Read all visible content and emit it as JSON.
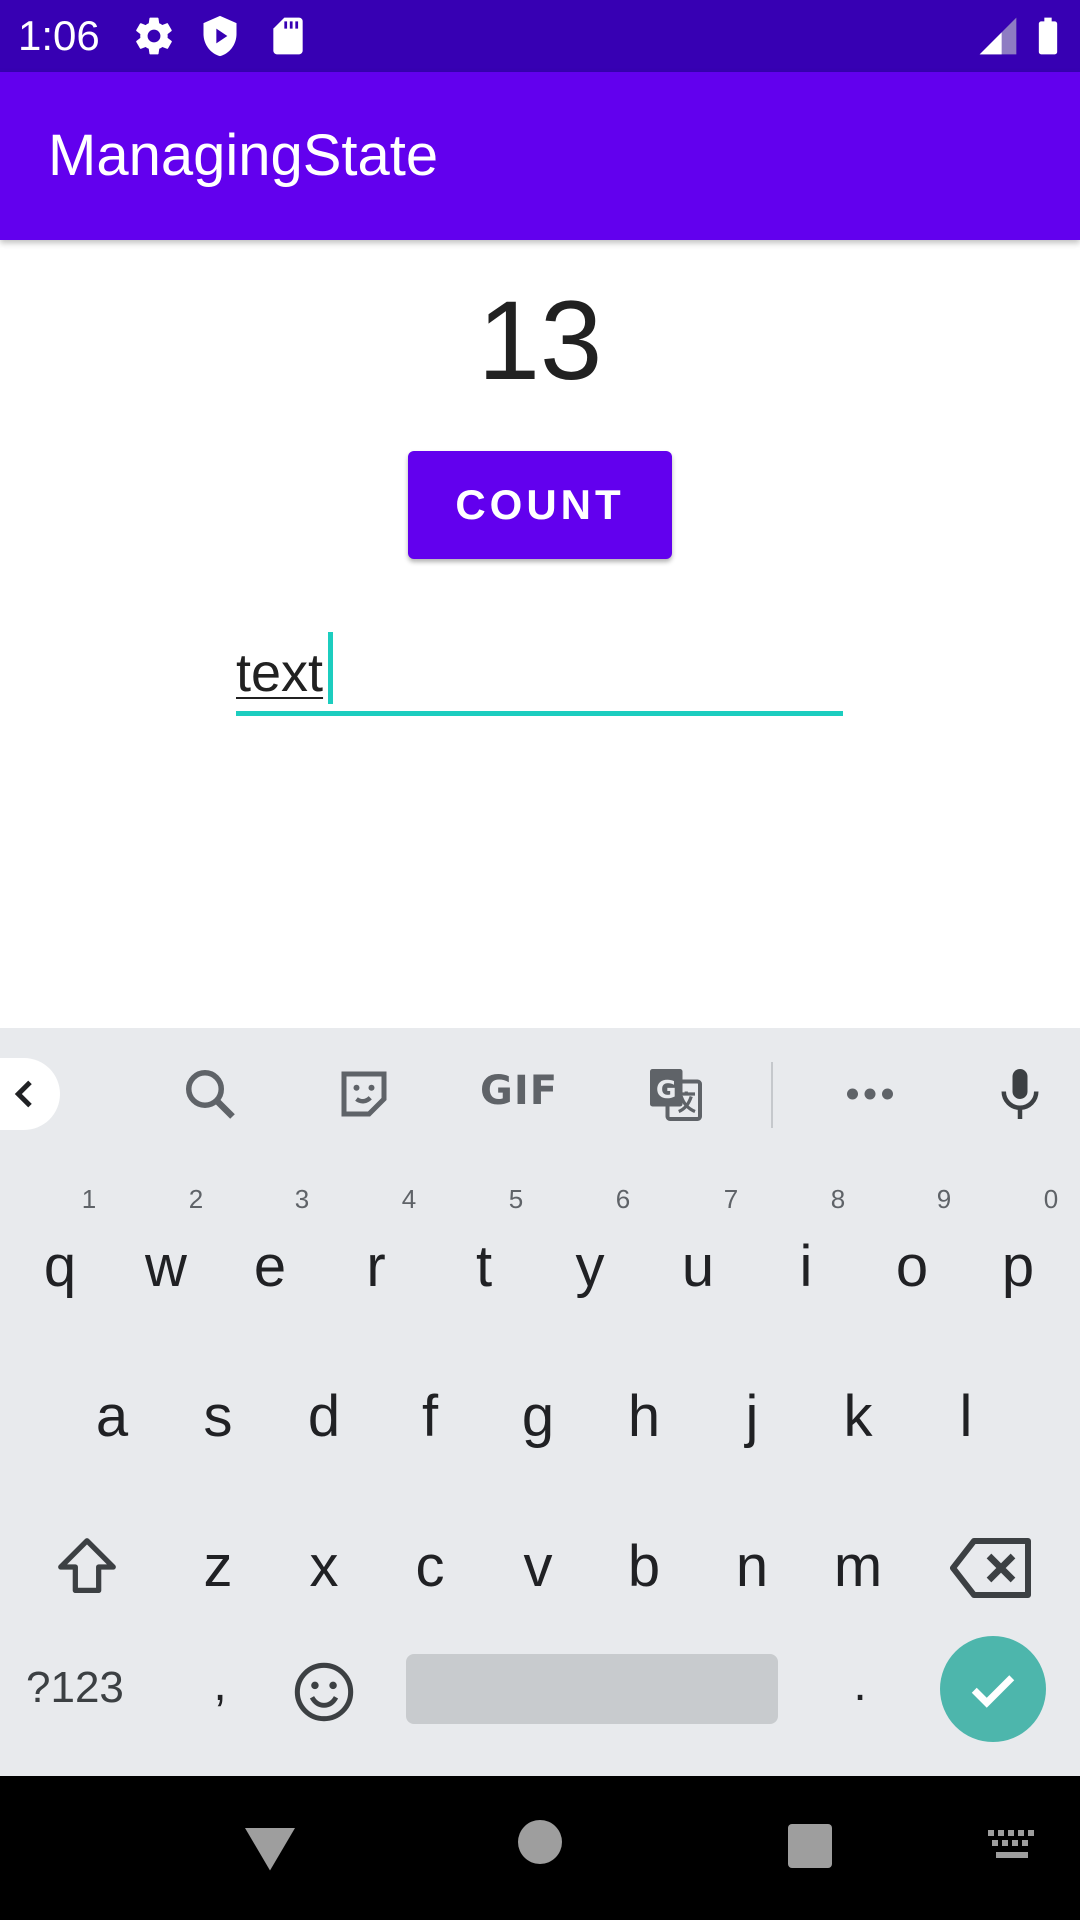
{
  "status_bar": {
    "time": "1:06",
    "icons": [
      "settings-icon",
      "shield-icon",
      "sd-card-icon",
      "signal-icon",
      "battery-icon"
    ]
  },
  "app_bar": {
    "title": "ManagingState",
    "color": "#6200ee"
  },
  "counter": {
    "value": "13"
  },
  "count_button": {
    "label": "COUNT"
  },
  "text_field": {
    "value": "text",
    "accent_color": "#1ccdbf"
  },
  "keyboard": {
    "toolbar": [
      "back-icon",
      "search-icon",
      "sticker-icon",
      "gif-icon",
      "translate-icon",
      "more-icon",
      "microphone-icon"
    ],
    "gif_label": "GIF",
    "row1": [
      {
        "key": "q",
        "hint": "1"
      },
      {
        "key": "w",
        "hint": "2"
      },
      {
        "key": "e",
        "hint": "3"
      },
      {
        "key": "r",
        "hint": "4"
      },
      {
        "key": "t",
        "hint": "5"
      },
      {
        "key": "y",
        "hint": "6"
      },
      {
        "key": "u",
        "hint": "7"
      },
      {
        "key": "i",
        "hint": "8"
      },
      {
        "key": "o",
        "hint": "9"
      },
      {
        "key": "p",
        "hint": "0"
      }
    ],
    "row2": [
      "a",
      "s",
      "d",
      "f",
      "g",
      "h",
      "j",
      "k",
      "l"
    ],
    "row3": [
      "z",
      "x",
      "c",
      "v",
      "b",
      "n",
      "m"
    ],
    "row4": {
      "symbols": "?123",
      "comma": ",",
      "period": "."
    },
    "enter_color": "#4db6ac"
  },
  "nav_bar": {
    "icons": [
      "back-icon",
      "home-icon",
      "recents-icon",
      "keyboard-icon"
    ]
  }
}
